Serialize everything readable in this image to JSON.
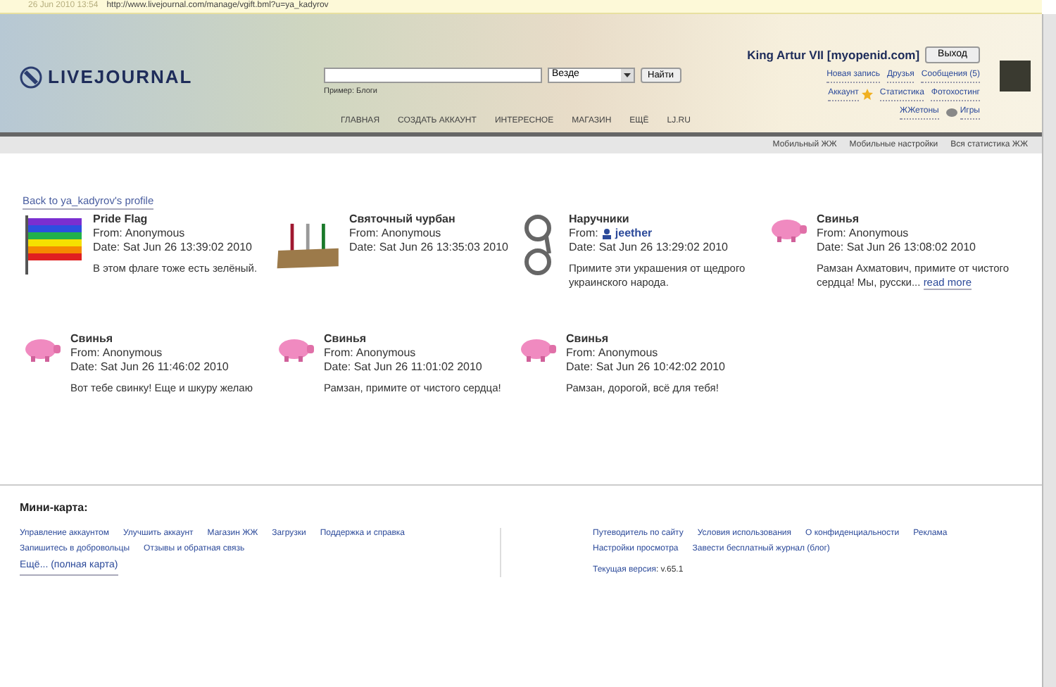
{
  "address_bar": {
    "date": "26 Jun 2010 13:54",
    "url": "http://www.livejournal.com/manage/vgift.bml?u=ya_kadyrov"
  },
  "header": {
    "logo": "LIVEJOURNAL",
    "search": {
      "scope": "Везде",
      "button": "Найти",
      "example": "Пример: Блоги"
    },
    "nav": [
      "ГЛАВНАЯ",
      "СОЗДАТЬ АККАУНТ",
      "ИНТЕРЕСНОЕ",
      "МАГАЗИН",
      "ЕЩЁ",
      "LJ.RU"
    ],
    "user": {
      "name": "King Artur VII [myopenid.com]",
      "logout": "Выход",
      "links": [
        [
          "Новая запись",
          "Друзья",
          "Сообщения (5)"
        ],
        [
          "Аккаунт",
          "Статистика",
          "Фотохостинг"
        ],
        [
          "ЖЖетоны",
          "Игры"
        ]
      ]
    }
  },
  "subnav": [
    "Мобильный ЖЖ",
    "Мобильные настройки",
    "Вся статистика ЖЖ"
  ],
  "back_link": "Back to ya_kadyrov's profile",
  "gifts": [
    {
      "kind": "flag",
      "title": "Pride Flag",
      "from_label": "From:",
      "sender": {
        "kind": "anonymous",
        "name": "Anonymous"
      },
      "date": "Date: Sat Jun 26 13:39:02 2010",
      "message": "В этом флаге тоже есть зелёный."
    },
    {
      "kind": "candles",
      "title": "Святочный чурбан",
      "from_label": "From:",
      "sender": {
        "kind": "anonymous",
        "name": "Anonymous"
      },
      "date": "Date: Sat Jun 26 13:35:03 2010"
    },
    {
      "kind": "handcuffs",
      "title": "Наручники",
      "from_label": "From:",
      "sender": {
        "kind": "user",
        "name": "jeether"
      },
      "date": "Date: Sat Jun 26 13:29:02 2010",
      "message": "Примите эти украшения от щедрого украинского народа."
    },
    {
      "kind": "pig",
      "title": "Свинья",
      "from_label": "From:",
      "sender": {
        "kind": "anonymous",
        "name": "Anonymous"
      },
      "date": "Date: Sat Jun 26 13:08:02 2010",
      "message": "Рамзан Ахматович, примите от чистого сердца! Мы, русски...",
      "read_more": "read more"
    },
    {
      "kind": "pig",
      "title": "Свинья",
      "from_label": "From:",
      "sender": {
        "kind": "anonymous",
        "name": "Anonymous"
      },
      "date": "Date: Sat Jun 26 11:46:02 2010",
      "message": "Вот тебе свинку! Еще и шкуру желаю"
    },
    {
      "kind": "pig",
      "title": "Свинья",
      "from_label": "From:",
      "sender": {
        "kind": "anonymous",
        "name": "Anonymous"
      },
      "date": "Date: Sat Jun 26 11:01:02 2010",
      "message": "Рамзан, примите от чистого сердца!"
    },
    {
      "kind": "pig",
      "title": "Свинья",
      "from_label": "From:",
      "sender": {
        "kind": "anonymous",
        "name": "Anonymous"
      },
      "date": "Date: Sat Jun 26 10:42:02 2010",
      "message": "Рамзан, дорогой, всё для тебя!"
    }
  ],
  "footer": {
    "title": "Мини-карта:",
    "left_links": [
      "Управление аккаунтом",
      "Улучшить аккаунт",
      "Магазин ЖЖ",
      "Загрузки",
      "Поддержка и справка",
      "Запишитесь в добровольцы",
      "Отзывы и обратная связь"
    ],
    "more": "Ещё... (полная карта)",
    "right_links": [
      "Путеводитель по сайту",
      "Условия использования",
      "О конфиденциальности",
      "Реклама",
      "Настройки просмотра",
      "Завести бесплатный журнал (блог)"
    ],
    "version_label": "Текущая версия",
    "version": ": v.65.1"
  }
}
